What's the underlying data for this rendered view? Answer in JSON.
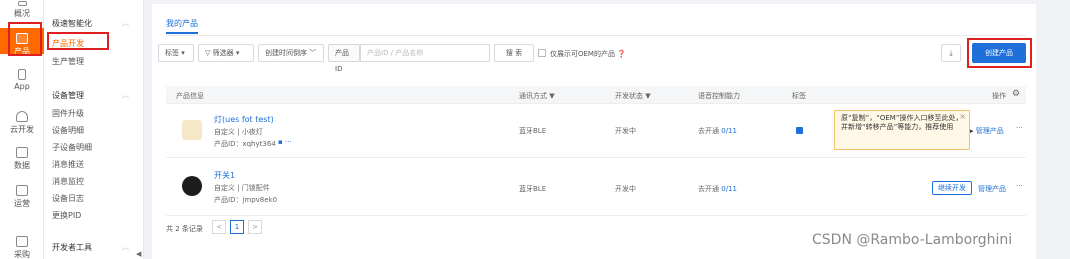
{
  "rail": {
    "items": [
      {
        "label": "概况"
      },
      {
        "label": "产品"
      },
      {
        "label": "App"
      },
      {
        "label": "云开发"
      },
      {
        "label": "数据"
      },
      {
        "label": "运营"
      },
      {
        "label": "采购"
      }
    ]
  },
  "submenu": {
    "group1": "极速智能化",
    "group1_items": [
      "产品开发",
      "生产管理"
    ],
    "group2": "设备管理",
    "group2_items": [
      "固件升级",
      "设备明细",
      "子设备明细",
      "消息推送",
      "消息监控",
      "设备日志",
      "更换PID"
    ],
    "group3": "开发者工具"
  },
  "main": {
    "tab": "我的产品",
    "filters": {
      "tag": "标签",
      "filter": "筛选器",
      "sort": "创建时间倒序",
      "pid_label": "产品ID",
      "search_placeholder": "产品ID / 产品名称",
      "search_button": "搜 索",
      "oem_checkbox": "仅展示可OEM的产品",
      "create_button": "创建产品",
      "download_icon": "download-icon"
    },
    "columns": [
      "产品信息",
      "通讯方式",
      "开发状态",
      "语音控制能力",
      "标签",
      "操作"
    ],
    "rows": [
      {
        "name": "灯(ues fot test)",
        "meta": "自定义 | 小夜灯",
        "pid": "产品ID：xqhyt364",
        "comm": "蓝牙BLE",
        "status": "开发中",
        "voice": "去开通",
        "voice_count": "0/11",
        "manage": "管理产品",
        "more": "···"
      },
      {
        "name": "开关1",
        "meta": "自定义 | 门锁配件",
        "pid": "产品ID：jmpv8ek0",
        "comm": "蓝牙BLE",
        "status": "开发中",
        "voice": "去开通",
        "voice_count": "0/11",
        "continue": "继续开发",
        "manage": "管理产品",
        "more": "···"
      }
    ],
    "tooltip": "原“复制”，“OEM”操作入口移至此处，并新增“转移产品”等能力，推荐使用",
    "tooltip_close": "×",
    "pager": {
      "total": "共 2 条记录",
      "prev": "<",
      "page": "1",
      "next": ">"
    }
  },
  "watermark": "CSDN @Rambo-Lamborghini",
  "colors": {
    "accent": "#1e6fd9",
    "brand": "#ff6a00",
    "highlight": "#e02020"
  }
}
